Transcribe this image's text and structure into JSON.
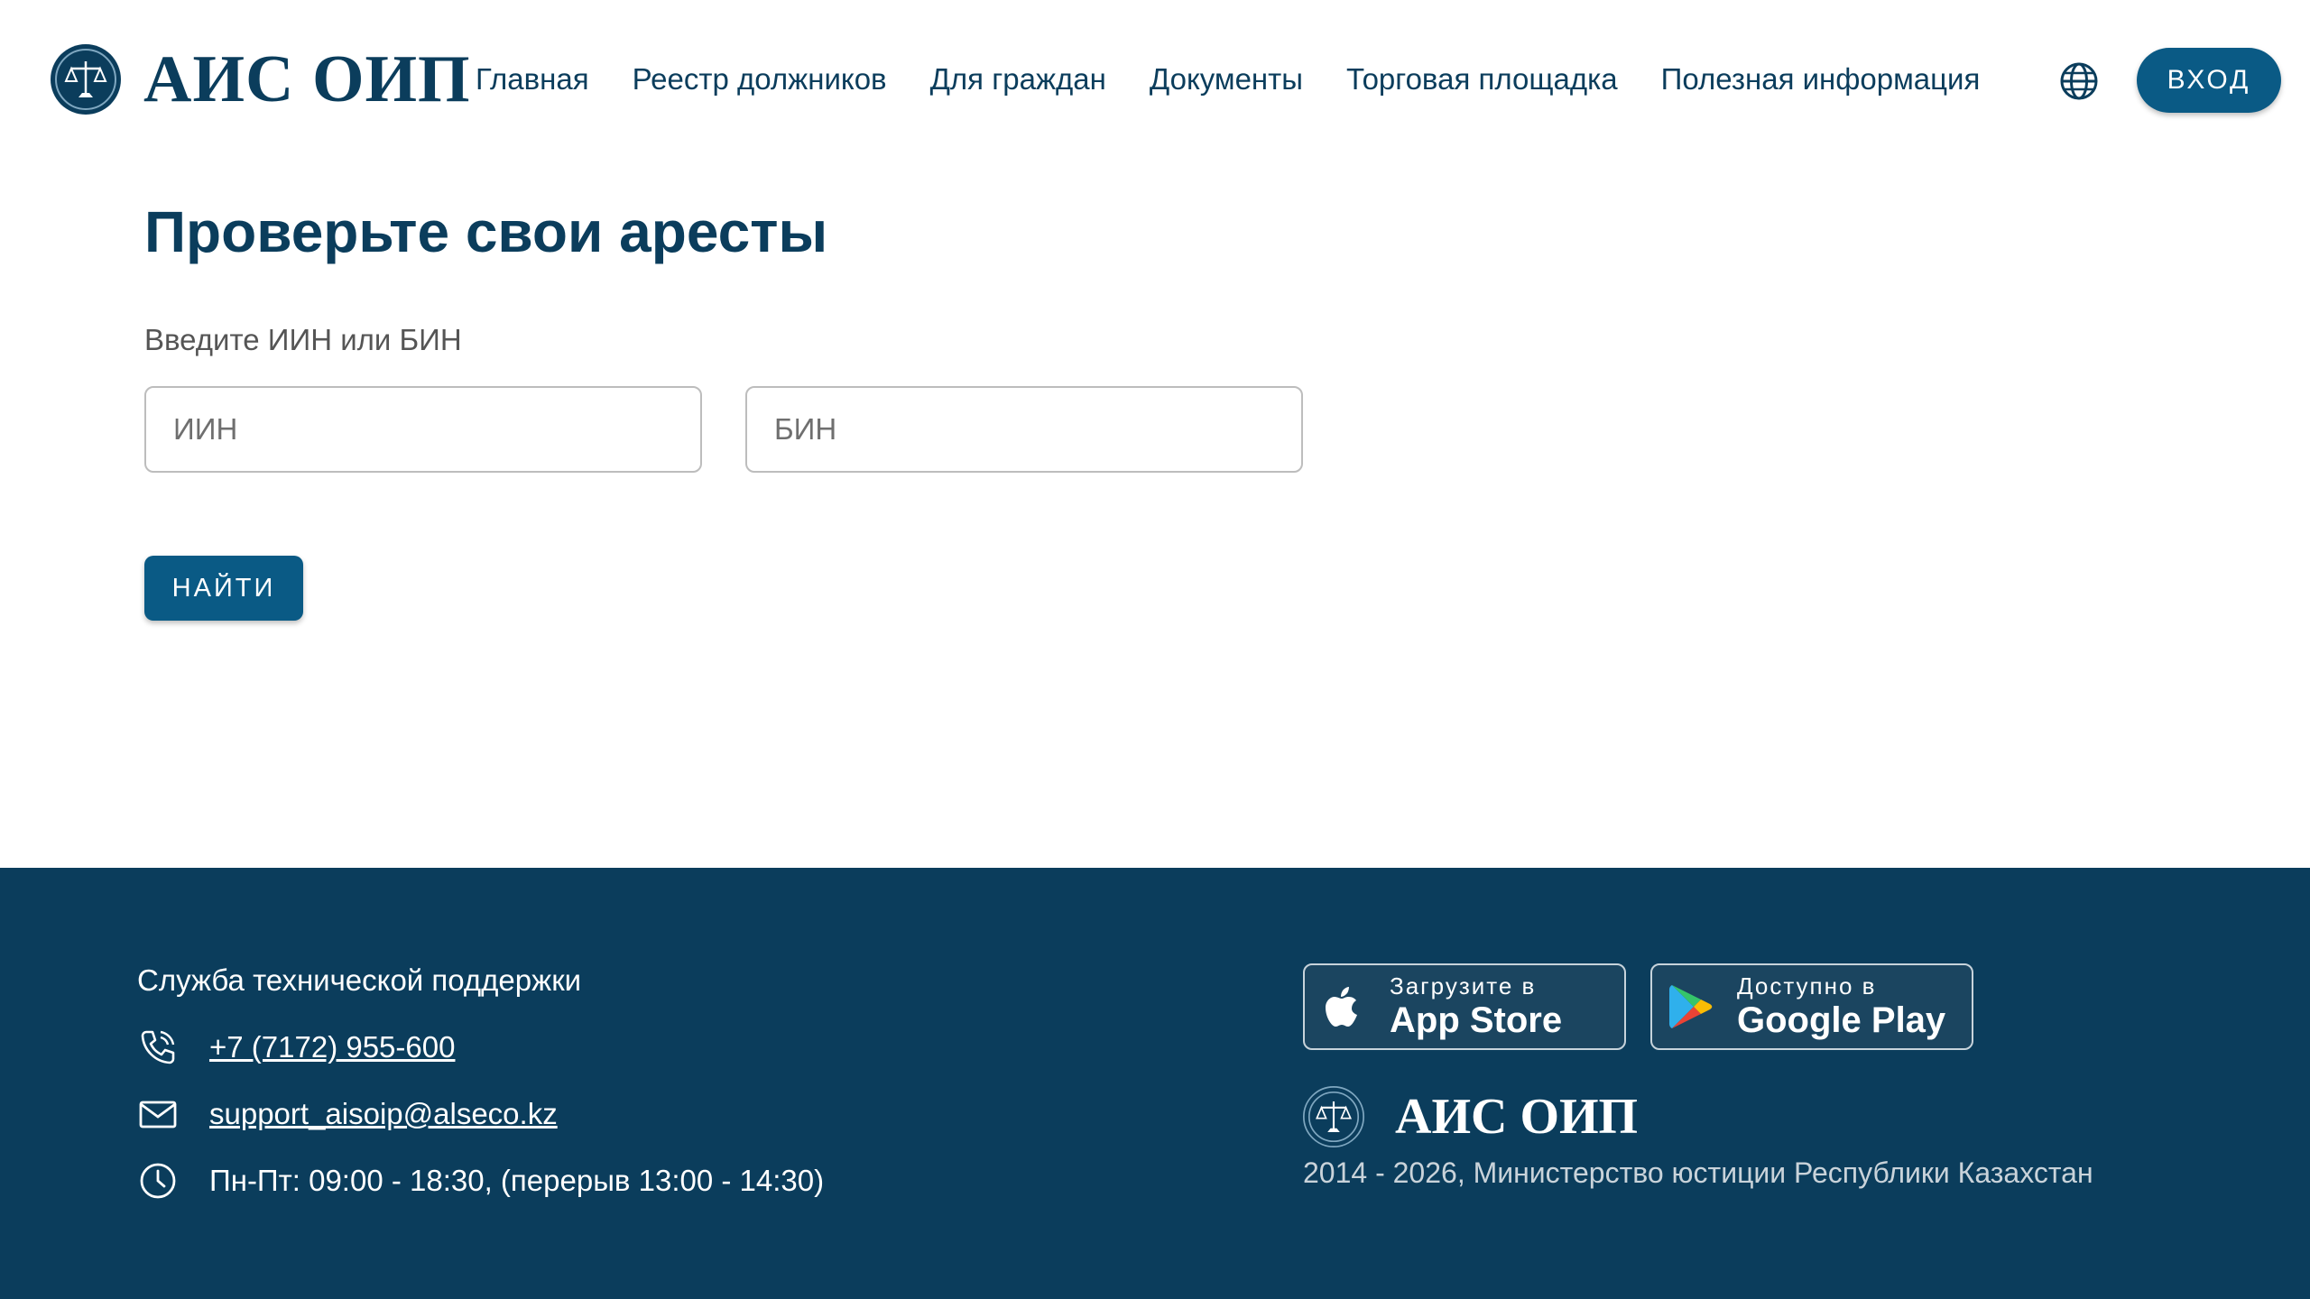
{
  "header": {
    "logo_text": "АИС ОИП",
    "nav": [
      "Главная",
      "Реестр должников",
      "Для граждан",
      "Документы",
      "Торговая площадка",
      "Полезная информация"
    ],
    "login_label": "ВХОД",
    "icons": {
      "emblem": "scales-emblem-icon",
      "language": "globe-icon"
    }
  },
  "main": {
    "title": "Проверьте свои аресты",
    "field_label": "Введите ИИН или БИН",
    "iin_placeholder": "ИИН",
    "bin_placeholder": "БИН",
    "search_label": "НАЙТИ"
  },
  "footer": {
    "support_title": "Служба технической поддержки",
    "phone": "+7 (7172) 955-600",
    "email": "support_aisoip@alseco.kz",
    "hours": "Пн-Пт: 09:00 - 18:30, (перерыв 13:00 - 14:30)",
    "app_store": {
      "small": "Загрузите в",
      "big": "App Store"
    },
    "google_play": {
      "small": "Доступно в",
      "big": "Google Play"
    },
    "logo_text": "АИС ОИП",
    "copyright": "2014 - 2026, Министерство юстиции Республики Казахстан",
    "icons": {
      "phone": "phone-icon",
      "mail": "mail-icon",
      "clock": "clock-icon",
      "apple": "apple-icon",
      "google_play": "google-play-icon"
    }
  },
  "colors": {
    "primary": "#0b3d5c",
    "button": "#0a5a85",
    "footer_bg": "#0b3d5c",
    "white": "#ffffff"
  }
}
